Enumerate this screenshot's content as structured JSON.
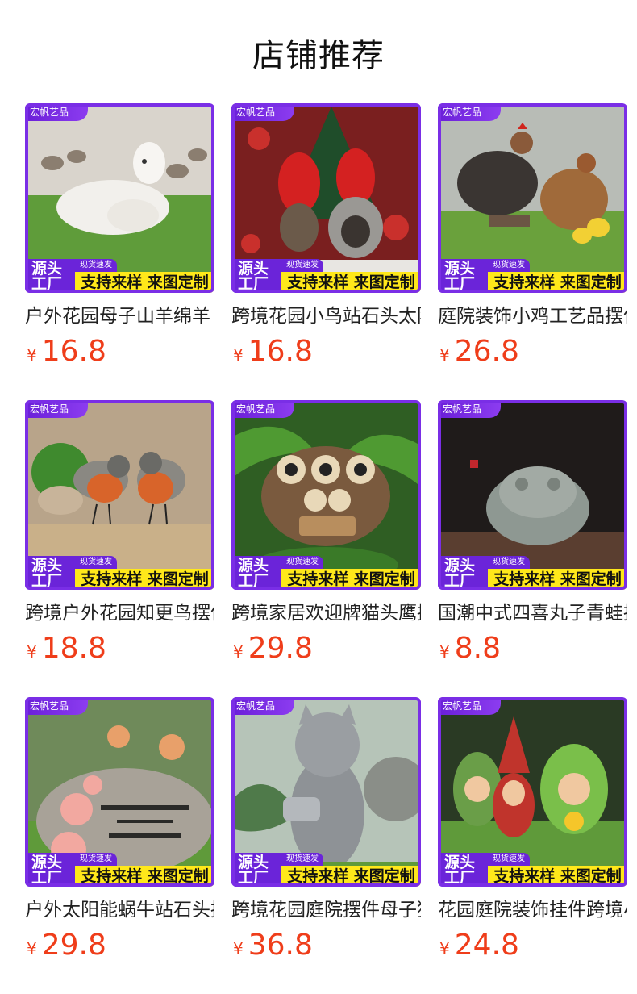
{
  "page_title": "店铺推荐",
  "badge": {
    "brand": "宏帆艺品",
    "source_line1": "源头",
    "source_line2": "工厂",
    "spot": "现货速发",
    "custom": "支持来样 来图定制"
  },
  "currency": "¥",
  "products": [
    {
      "name": "户外花园母子山羊绵羊",
      "price": "16.8",
      "icon": "sheep-statue-icon",
      "bg": "#5f9c3a"
    },
    {
      "name": "跨境花园小鸟站石头太阳能灯",
      "price": "16.8",
      "icon": "cardinal-birds-icon",
      "bg": "#7a1f1f"
    },
    {
      "name": "庭院装饰小鸡工艺品摆件",
      "price": "26.8",
      "icon": "rooster-hen-icon",
      "bg": "#86a860"
    },
    {
      "name": "跨境户外花园知更鸟摆件",
      "price": "18.8",
      "icon": "robin-birds-icon",
      "bg": "#b8a48a"
    },
    {
      "name": "跨境家居欢迎牌猫头鹰摆件",
      "price": "29.8",
      "icon": "owl-welcome-icon",
      "bg": "#3f7a2e"
    },
    {
      "name": "国潮中式四喜丸子青蛙摆件",
      "price": "8.8",
      "icon": "toad-statue-icon",
      "bg": "#2b2624"
    },
    {
      "name": "户外太阳能蜗牛站石头摆件",
      "price": "29.8",
      "icon": "welcome-stone-icon",
      "bg": "#7aa258"
    },
    {
      "name": "跨境花园庭院摆件母子猫",
      "price": "36.8",
      "icon": "cat-statue-icon",
      "bg": "#9bb0a0"
    },
    {
      "name": "花园庭院装饰挂件跨境小矮人",
      "price": "24.8",
      "icon": "gnomes-icon",
      "bg": "#68a446"
    }
  ]
}
